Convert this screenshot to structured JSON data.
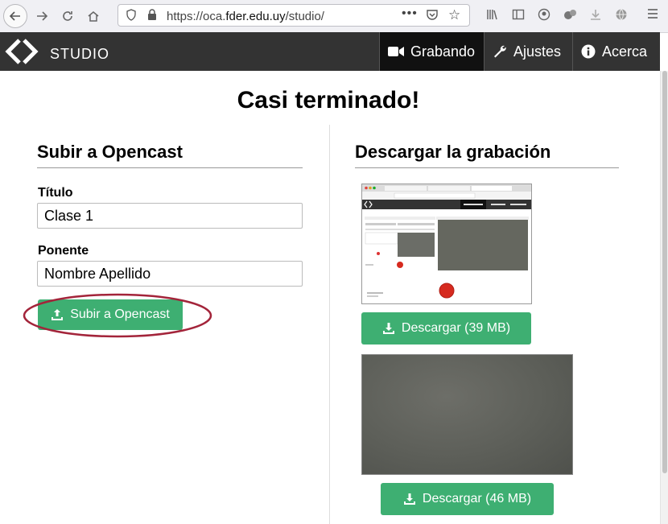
{
  "browser": {
    "url_prefix": "https://oca.",
    "url_domain": "fder.edu.uy",
    "url_suffix": "/studio/"
  },
  "header": {
    "brand": "STUDIO",
    "nav": [
      {
        "label": "Grabando",
        "icon": "video-camera-icon"
      },
      {
        "label": "Ajustes",
        "icon": "wrench-icon"
      },
      {
        "label": "Acerca",
        "icon": "info-icon"
      }
    ]
  },
  "main": {
    "title": "Casi terminado!",
    "upload": {
      "heading": "Subir a Opencast",
      "title_label": "Título",
      "title_value": "Clase 1",
      "presenter_label": "Ponente",
      "presenter_value": "Nombre Apellido",
      "button": "Subir a Opencast"
    },
    "download": {
      "heading": "Descargar la grabación",
      "button1": "Descargar (39 MB)",
      "button2": "Descargar (46 MB)"
    }
  },
  "colors": {
    "accent": "#3eaf72",
    "header_bg": "#333333",
    "highlight_ellipse": "#a3243a"
  }
}
